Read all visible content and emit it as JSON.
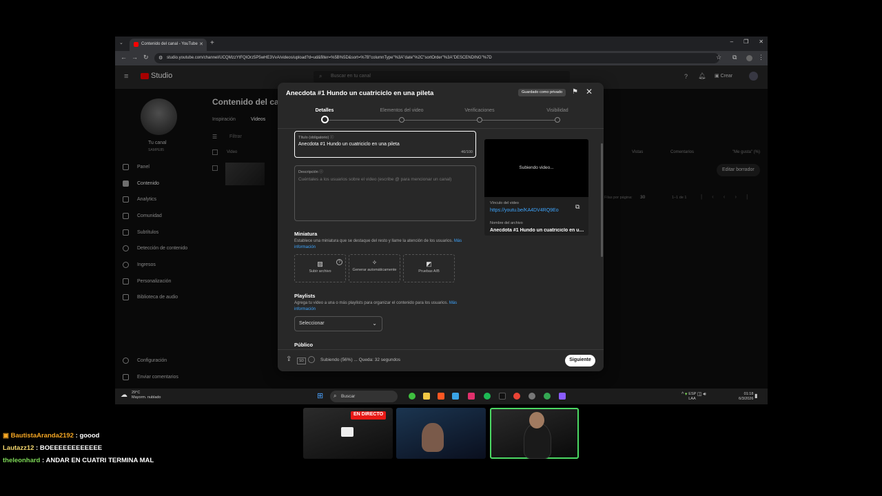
{
  "browser": {
    "tab_title": "Contenido del canal - YouTube",
    "new_tab": "+",
    "url": "studio.youtube.com/channel/UCQMzzYtFQIOrz5P5wHE3VvA/videos/upload?d=ud&filter=%5B%5D&sort=%7B\"columnType\"%3A\"date\"%2C\"sortOrder\"%3A\"DESCENDING\"%7D"
  },
  "studio": {
    "logo": "Studio",
    "search_placeholder": "Buscar en tu canal",
    "create_label": "Crear",
    "channel_label": "Tu canal",
    "channel_name": "SAMPE85",
    "page_title": "Contenido del canal",
    "tabs": [
      "Inspiración",
      "Videos"
    ],
    "filter_placeholder": "Filtrar",
    "column_video": "Video",
    "columns_right": [
      "Vistas",
      "Comentarios",
      "\"Me gusta\" (%)"
    ],
    "draft_button": "Editar borrador",
    "rows_per_page_label": "Filas por página:",
    "rows_per_page": "30",
    "range": "1–1 de 1",
    "sidebar": [
      {
        "label": "Panel",
        "icon": "dashboard-icon"
      },
      {
        "label": "Contenido",
        "icon": "content-icon"
      },
      {
        "label": "Analytics",
        "icon": "analytics-icon"
      },
      {
        "label": "Comunidad",
        "icon": "community-icon"
      },
      {
        "label": "Subtítulos",
        "icon": "subtitles-icon"
      },
      {
        "label": "Detección de contenido",
        "icon": "copyright-icon"
      },
      {
        "label": "Ingresos",
        "icon": "dollar-icon"
      },
      {
        "label": "Personalización",
        "icon": "magic-icon"
      },
      {
        "label": "Biblioteca de audio",
        "icon": "audio-library-icon"
      }
    ],
    "sidebar_bottom": [
      "Configuración",
      "Enviar comentarios"
    ]
  },
  "modal": {
    "title": "Anecdota #1 Hundo un cuatriciclo en una pileta",
    "saved_badge": "Guardado como privado",
    "steps": [
      "Detalles",
      "Elementos del video",
      "Verificaciones",
      "Visibilidad"
    ],
    "active_step": 0,
    "title_label": "Título (obligatorio)",
    "title_value": "Anecdota #1 Hundo un cuatriciclo en una pileta",
    "title_count": "46/100",
    "desc_label": "Descripción",
    "desc_placeholder": "Cuéntales a los usuarios sobre el video (escribe @ para mencionar un canal)",
    "preview_status": "Subiendo video...",
    "link_label": "Vínculo del video",
    "link_value": "https://youtu.be/KA4DV4RQ9Eo",
    "file_label": "Nombre del archivo",
    "file_value": "Anecdota #1 Hundo un cuatriciclo en una pileta",
    "thumb_title": "Miniatura",
    "thumb_desc": "Establece una miniatura que se destaque del resto y llame la atención de los usuarios.",
    "thumb_more": "Más información",
    "thumb_buttons": [
      "Subir archivo",
      "Generar automáticamente",
      "Pruebas A/B"
    ],
    "playlist_title": "Playlists",
    "playlist_desc": "Agrega tu video a una o más playlists para organizar el contenido para los usuarios.",
    "playlist_more": "Más información",
    "playlist_select": "Seleccionar",
    "audience_title": "Público",
    "progress": "Subiendo (56%) ... Queda: 32 segundos",
    "next_button": "Siguiente"
  },
  "taskbar": {
    "weather_temp": "29°C",
    "weather_desc": "Mayorm. nublado",
    "search": "Buscar",
    "lang": "ESP",
    "lang2": "LAA",
    "time": "01:18",
    "date": "6/3/2026"
  },
  "stream": {
    "live_badge": "EN DIRECTO",
    "chat": [
      {
        "user": "BautistaAranda2192",
        "message": "goood",
        "color": "#f5a623"
      },
      {
        "user": "Lautazz12",
        "message": "BOEEEEEEEEEEEE",
        "color": "#f5d76e"
      },
      {
        "user": "theleonhard",
        "message": "ANDAR EN CUATRI TERMINA MAL",
        "color": "#7ed957"
      }
    ]
  }
}
